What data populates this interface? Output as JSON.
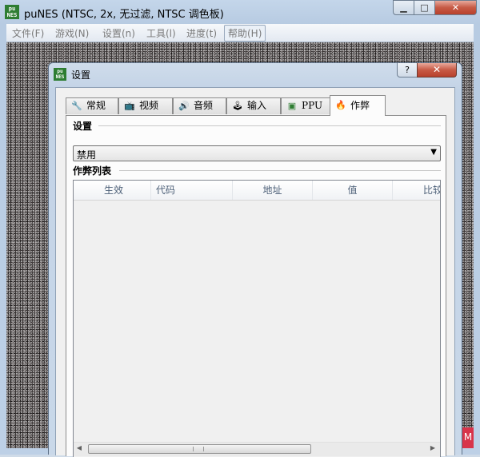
{
  "window": {
    "title": "puNES (NTSC, 2x, 无过滤, NTSC 调色板)",
    "app_icon_text": "pu\nNES",
    "minimize_symbol": "▁",
    "maximize_symbol": "□",
    "close_symbol": "✕"
  },
  "menu": {
    "items": [
      "文件(F)",
      "游戏(N)",
      "设置(n)",
      "工具(l)",
      "进度(t)",
      "帮助(H)"
    ],
    "active_index": 5
  },
  "dialog": {
    "title": "设置",
    "help_symbol": "?",
    "close_symbol": "✕",
    "tabs": [
      {
        "label": "常规",
        "icon": "wrench-icon",
        "glyph": "🔧"
      },
      {
        "label": "视频",
        "icon": "tv-icon",
        "glyph": "📺"
      },
      {
        "label": "音频",
        "icon": "speaker-icon",
        "glyph": "🔊"
      },
      {
        "label": "输入",
        "icon": "joystick-icon",
        "glyph": "🕹"
      },
      {
        "label": "PPU",
        "icon": "chip-icon",
        "glyph": "▣"
      },
      {
        "label": "作弊",
        "icon": "flame-icon",
        "glyph": "🔥"
      }
    ],
    "selected_tab": 5,
    "settings_group_title": "设置",
    "mode_value": "禁用",
    "combo_arrow": "▼",
    "cheat_list_title": "作弊列表",
    "columns": [
      "生效",
      "代码",
      "地址",
      "值",
      "比较"
    ],
    "scroll_left": "◀",
    "scroll_right": "▶"
  },
  "colors": {
    "close_red": "#c75a45",
    "frame_blue": "#c4d6ea"
  }
}
